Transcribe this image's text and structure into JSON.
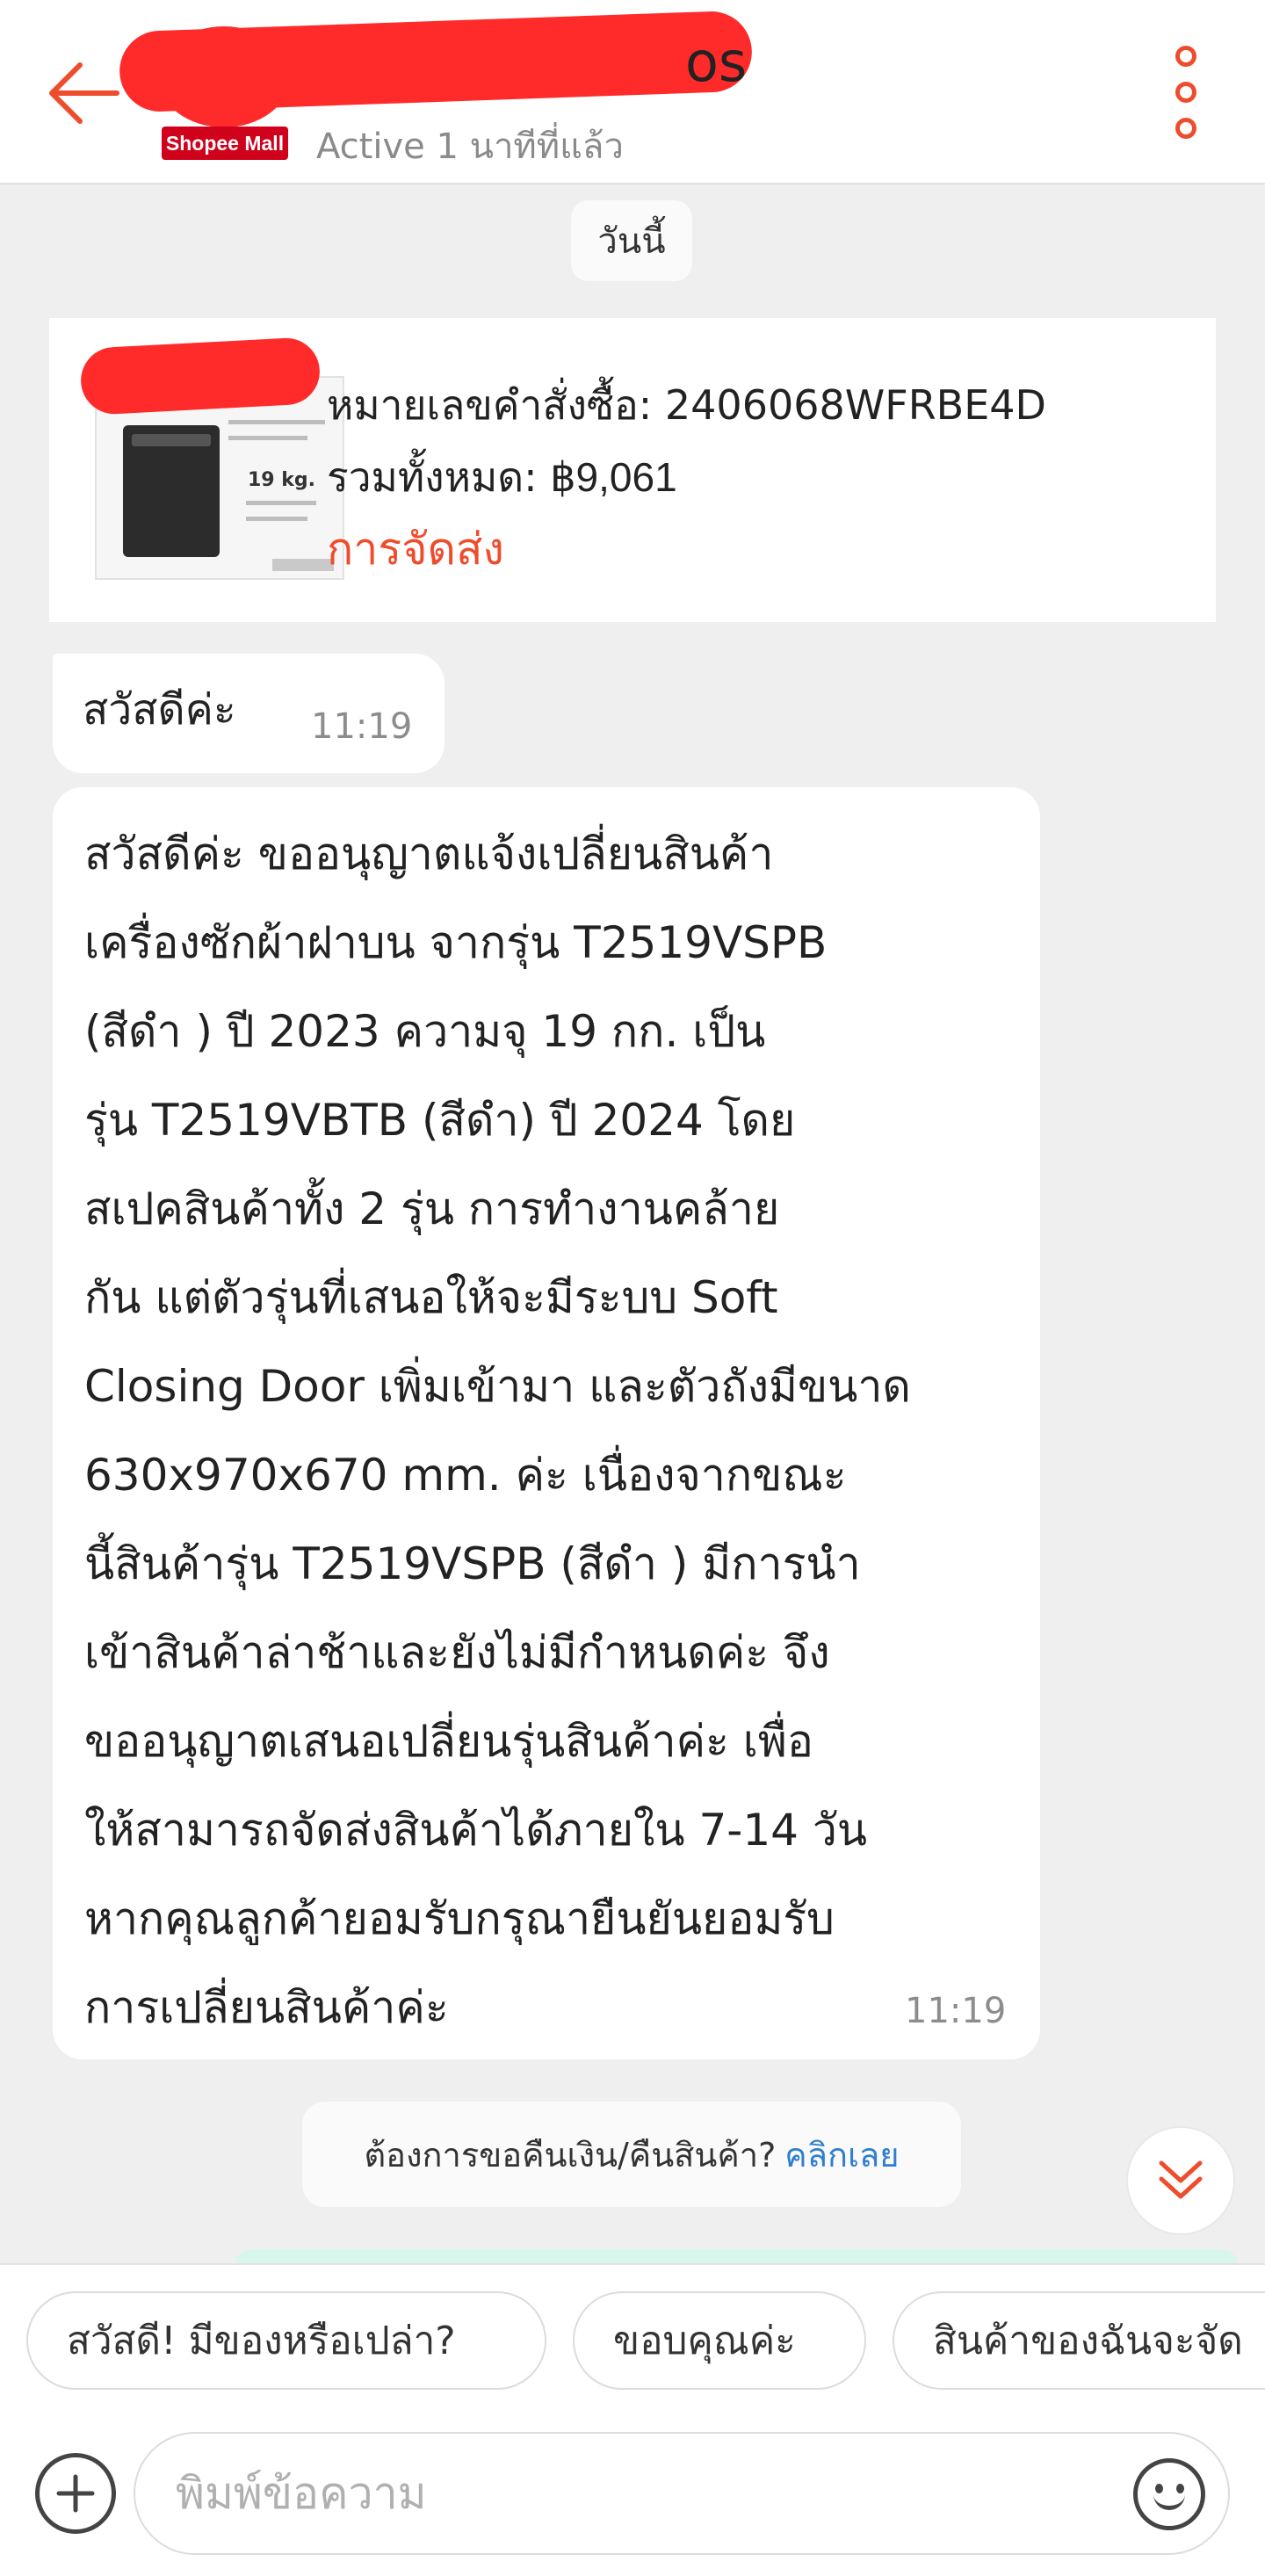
{
  "header": {
    "shop_name_visible": "os",
    "mall_badge": "Shopee Mall",
    "active_status": "Active 1 นาทีที่แล้ว",
    "back_icon": "arrow-left-icon",
    "more_icon": "more-vertical-icon",
    "accent_color": "#ee4d2d"
  },
  "date_separator": "วันนี้",
  "order_card": {
    "order_number_label": "หมายเลขคำสั่งซื้อ: ",
    "order_number": "2406068WFRBE4D",
    "total_label": "รวมทั้งหมด: ",
    "total_value": "฿9,061",
    "status": "การจัดส่ง",
    "thumbnail_weight": "19 kg."
  },
  "messages": [
    {
      "text": "สวัสดีค่ะ",
      "time": "11:19"
    },
    {
      "text": "สวัสดีค่ะ ขออนุญาตแจ้งเปลี่ยนสินค้า\nเครื่องซักผ้าฝาบน จากรุ่น T2519VSPB\n(สีดำ ) ปี 2023  ความจุ 19 กก.   เป็น\nรุ่น T2519VBTB  (สีดำ)  ปี 2024  โดย\nสเปคสินค้าทั้ง 2 รุ่น การทำงานคล้าย\nกัน แต่ตัวรุ่นที่เสนอให้จะมีระบบ Soft\nClosing Door เพิ่มเข้ามา และตัวถังมีขนาด\n630x970x670 mm. ค่ะ   เนื่องจากขณะ\nนี้สินค้ารุ่น T2519VSPB (สีดำ )  มีการนำ\nเข้าสินค้าล่าช้าและยังไม่มีกำหนดค่ะ จึง\nขออนุญาตเสนอเปลี่ยนรุ่นสินค้าค่ะ  เพื่อ\nให้สามารถจัดส่งสินค้าได้ภายใน 7-14 วัน\nหากคุณลูกค้ายอมรับกรุณายืนยันยอมรับ\nการเปลี่ยนสินค้าค่ะ",
      "time": "11:19"
    }
  ],
  "return_prompt": {
    "text": "ต้องการขอคืนเงิน/คืนสินค้า?",
    "link": "คลิกเลย",
    "link_color": "#2f7fd1"
  },
  "scroll_down_icon": "chevron-double-down-icon",
  "quick_replies": [
    "สวัสดี! มีของหรือเปล่า?",
    "ขอบคุณค่ะ",
    "สินค้าของฉันจะจัด"
  ],
  "composer": {
    "placeholder": "พิมพ์ข้อความ",
    "add_icon": "plus-circle-icon",
    "emoji_icon": "smiley-icon"
  }
}
